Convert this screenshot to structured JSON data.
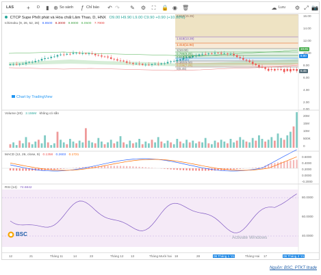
{
  "toolbar": {
    "symbol": "LAS",
    "timeframe": "D",
    "compare": "So sánh",
    "indicators": "Chỉ báo",
    "save": "Lưu"
  },
  "legend": {
    "name": "CTCP Supe Phốt phát và Hóa chất Lâm Thao, D, HNX",
    "ohlc": "O9.00 H9.90 L9.00 C9.90 +0.90 (+10.00%)",
    "ichimoku_label": "Ichimoku (9, 26, 52, 26)",
    "ichimoku_values": [
      "8.8500",
      "8.3000",
      "9.9000",
      "8.0500",
      "7.7000"
    ],
    "volume_label": "Volume (20)",
    "volume_value": "2.155M",
    "volume_note": "không có sẵn",
    "macd_label": "MACD (12, 26, close, 9)",
    "macd_values": [
      "0.1358",
      "0.2603",
      "0.1721"
    ],
    "rsi_label": "RSI (14)",
    "rsi_value": "74.6842"
  },
  "fib_labels": [
    "2.618(15.35)",
    "1.618(13.39)",
    "1.414(11.94)",
    "1(10.00)",
    "0.786(9.25)",
    "0.618(8.85)",
    "0.5(8.40)",
    "0.382(8.00)",
    "0.236(7.29)",
    "0(6.45)"
  ],
  "price_axis": [
    "16.00",
    "14.00",
    "12.00",
    "10.00",
    "8.00",
    "6.00",
    "4.00",
    "2.00",
    "0.00"
  ],
  "price_tags": {
    "hi": "10.81",
    "cur": "9.90",
    "lo": "6.45"
  },
  "volume_axis": [
    "20M",
    "15M",
    "10M",
    "500K",
    "0"
  ],
  "macd_axis": [
    "0.6000",
    "0.4000",
    "0.2000",
    "0.0000",
    "-0.2000"
  ],
  "rsi_axis": [
    "80.0000",
    "60.0000",
    "40.0000"
  ],
  "x_axis": [
    "12",
    "21",
    "Tháng 11",
    "14",
    "23",
    "Tháng 12",
    "13",
    "Tháng Mười hai",
    "18",
    "28",
    "08 Tháng 1 '21",
    "Tháng Hai",
    "17",
    "08 Tháng 3 '21"
  ],
  "tradingview": "Chart by TradingView",
  "logo": "BSC",
  "watermark": "Activate Windows",
  "source": "Nguồn: BSC, PTKT Itrade",
  "colors": {
    "up": "#26a69a",
    "down": "#ef5350",
    "rsi_band": "#f3e5f5",
    "rsi_line": "#7e57c2",
    "macd": "#2962ff",
    "signal": "#ff6d00"
  }
}
